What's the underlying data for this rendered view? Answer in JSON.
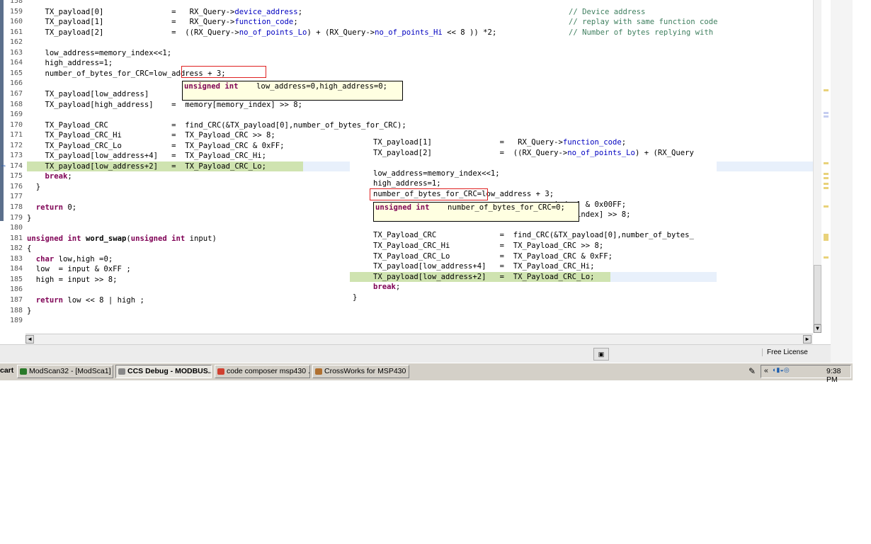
{
  "editor_left": {
    "lines": [
      {
        "n": "158",
        "code": ""
      },
      {
        "n": "159",
        "segs": [
          [
            "",
            "    TX_payload[0]               =   RX_Query->"
          ],
          [
            "fld",
            "device_address"
          ],
          [
            "",
            ";"
          ]
        ],
        "comment": "// Device address"
      },
      {
        "n": "160",
        "segs": [
          [
            "",
            "    TX_payload[1]               =   RX_Query->"
          ],
          [
            "fld",
            "function_code"
          ],
          [
            "",
            ";"
          ]
        ],
        "comment": "// replay with same function code"
      },
      {
        "n": "161",
        "segs": [
          [
            "",
            "    TX_payload[2]               =  ((RX_Query->"
          ],
          [
            "fld",
            "no_of_points_Lo"
          ],
          [
            "",
            ") + (RX_Query->"
          ],
          [
            "fld",
            "no_of_points_Hi"
          ],
          [
            "",
            " << 8 )) *2;"
          ]
        ],
        "comment": "// Number of bytes replying with"
      },
      {
        "n": "162",
        "code": ""
      },
      {
        "n": "163",
        "code": "    low_address=memory_index<<1;"
      },
      {
        "n": "164",
        "code": "    high_address=1;"
      },
      {
        "n": "165",
        "code": "    number_of_bytes_for_CRC=low_address + 3;"
      },
      {
        "n": "166",
        "code": ""
      },
      {
        "n": "167",
        "code": "    TX_payload[low_address]"
      },
      {
        "n": "168",
        "code": "    TX_payload[high_address]    =  memory[memory_index] >> 8;"
      },
      {
        "n": "169",
        "code": ""
      },
      {
        "n": "170",
        "code": "    TX_Payload_CRC              =  find_CRC(&TX_payload[0],number_of_bytes_for_CRC);"
      },
      {
        "n": "171",
        "code": "    TX_Payload_CRC_Hi           =  TX_Payload_CRC >> 8;"
      },
      {
        "n": "172",
        "code": "    TX_Payload_CRC_Lo           =  TX_Payload_CRC & 0xFF;"
      },
      {
        "n": "173",
        "code": "    TX_payload[low_address+4]   =  TX_Payload_CRC_Hi;"
      },
      {
        "n": "174",
        "code": "    TX_payload[low_address+2]   =  TX_Payload_CRC_Lo;"
      },
      {
        "n": "175",
        "segs": [
          [
            "",
            "    "
          ],
          [
            "kw",
            "break"
          ],
          [
            "",
            ";"
          ]
        ]
      },
      {
        "n": "176",
        "code": "  }"
      },
      {
        "n": "177",
        "code": ""
      },
      {
        "n": "178",
        "segs": [
          [
            "",
            "  "
          ],
          [
            "kw",
            "return"
          ],
          [
            "",
            " 0;"
          ]
        ]
      },
      {
        "n": "179",
        "code": "}"
      },
      {
        "n": "180",
        "code": ""
      },
      {
        "n": "181",
        "segs": [
          [
            "kw",
            "unsigned int"
          ],
          [
            "",
            " "
          ],
          [
            "fn",
            "word_swap"
          ],
          [
            "",
            "("
          ],
          [
            "kw",
            "unsigned int"
          ],
          [
            "",
            " input)"
          ]
        ]
      },
      {
        "n": "182",
        "code": "{"
      },
      {
        "n": "183",
        "segs": [
          [
            "",
            "  "
          ],
          [
            "kw",
            "char"
          ],
          [
            "",
            " low,high =0;"
          ]
        ]
      },
      {
        "n": "184",
        "code": "  low  = input & 0xFF ;"
      },
      {
        "n": "185",
        "code": "  high = input >> 8;"
      },
      {
        "n": "186",
        "code": ""
      },
      {
        "n": "187",
        "segs": [
          [
            "",
            "  "
          ],
          [
            "kw",
            "return"
          ],
          [
            "",
            " low << 8 | high ;"
          ]
        ]
      },
      {
        "n": "188",
        "code": "}"
      },
      {
        "n": "189",
        "code": ""
      }
    ],
    "hover": {
      "type": "unsigned int",
      "text": "    low_address=0,high_address=0;"
    }
  },
  "editor_right": {
    "lines": [
      {
        "segs": [
          [
            "",
            "TX_payload[1]               =   RX_Query->"
          ],
          [
            "fld",
            "function_code"
          ],
          [
            "",
            ";"
          ]
        ]
      },
      {
        "segs": [
          [
            "",
            "TX_payload[2]               =  ((RX_Query->"
          ],
          [
            "fld",
            "no_of_points_Lo"
          ],
          [
            "",
            ") + (RX_Query"
          ]
        ]
      },
      {
        "code": ""
      },
      {
        "code": "low_address=memory_index<<1;"
      },
      {
        "code": "high_address=1;"
      },
      {
        "code": "number_of_bytes_for_CRC=low_address + 3;"
      },
      {
        "code": "                                      y_index] & 0x00FF;"
      },
      {
        "code": "TX_payload[high_address]    =  memory[memory_index] >> 8;"
      },
      {
        "code": ""
      },
      {
        "code": "TX_Payload_CRC              =  find_CRC(&TX_payload[0],number_of_bytes_"
      },
      {
        "code": "TX_Payload_CRC_Hi           =  TX_Payload_CRC >> 8;"
      },
      {
        "code": "TX_Payload_CRC_Lo           =  TX_Payload_CRC & 0xFF;"
      },
      {
        "code": "TX_payload[low_address+4]   =  TX_Payload_CRC_Hi;"
      },
      {
        "code": "TX_payload[low_address+2]   =  TX_Payload_CRC_Lo;"
      },
      {
        "segs": [
          [
            "kw",
            "break"
          ],
          [
            "",
            ";"
          ]
        ]
      },
      {
        "code": "}"
      }
    ],
    "hover": {
      "type": "unsigned int",
      "text": "    number_of_bytes_for_CRC=0;"
    }
  },
  "status": {
    "license": "Free License"
  },
  "taskbar": {
    "start": "cart",
    "buttons": [
      {
        "label": "ModScan32 - [ModSca1]",
        "color": "#2a7a2a"
      },
      {
        "label": "CCS Debug - MODBUS...",
        "color": "#888888"
      },
      {
        "label": "code composer msp430 ...",
        "color": "#d04030"
      },
      {
        "label": "CrossWorks for MSP430 ...",
        "color": "#b07030"
      }
    ],
    "clock": "9:38 PM"
  }
}
